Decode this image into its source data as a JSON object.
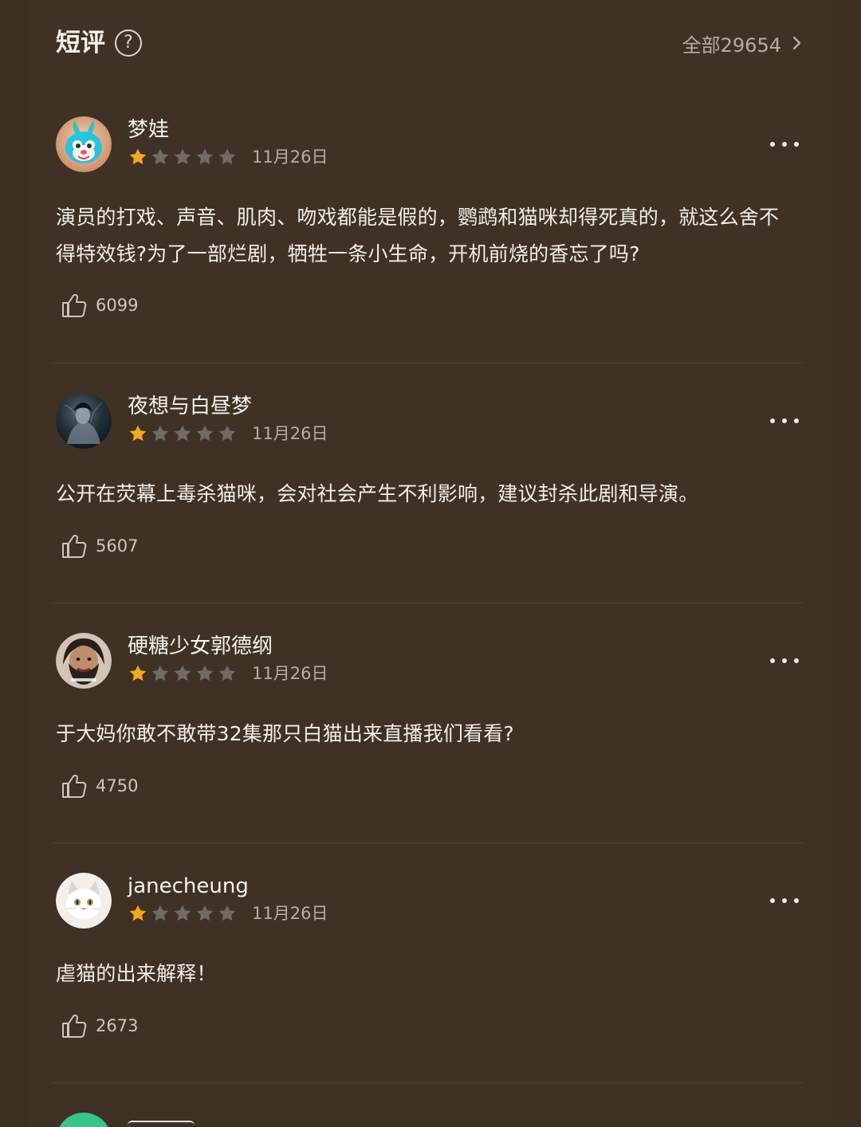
{
  "section": {
    "title": "短评",
    "help_icon": "question-circle-icon",
    "all_label": "全部29654",
    "all_icon": "chevron-right-icon"
  },
  "reviews": [
    {
      "user": "梦娃",
      "rating": 1,
      "max_rating": 5,
      "date": "11月26日",
      "text": "演员的打戏、声音、肌肉、吻戏都能是假的，鹦鹉和猫咪却得死真的，就这么舍不得特效钱?为了一部烂剧，牺牲一条小生命，开机前烧的香忘了吗?",
      "likes": "6099",
      "avatar": "cartoon-rabbit-avatar"
    },
    {
      "user": "夜想与白昼梦",
      "rating": 1,
      "max_rating": 5,
      "date": "11月26日",
      "text": "公开在荧幕上毒杀猫咪，会对社会产生不利影响，建议封杀此剧和导演。",
      "likes": "5607",
      "avatar": "dark-portrait-avatar"
    },
    {
      "user": "硬糖少女郭德纲",
      "rating": 1,
      "max_rating": 5,
      "date": "11月26日",
      "text": "于大妈你敢不敢带32集那只白猫出来直播我们看看?",
      "likes": "4750",
      "avatar": "bearded-man-avatar"
    },
    {
      "user": "janecheung",
      "rating": 1,
      "max_rating": 5,
      "date": "11月26日",
      "text": "虐猫的出来解释！",
      "likes": "2673",
      "avatar": "white-cat-avatar"
    }
  ],
  "colors": {
    "background": "#3b3021",
    "panel": "#3f3224",
    "text": "#f3eee8",
    "muted": "#b8aea3",
    "star_active": "#f5a623",
    "star_inactive": "#6f6b66",
    "divider": "#4c3f31"
  }
}
